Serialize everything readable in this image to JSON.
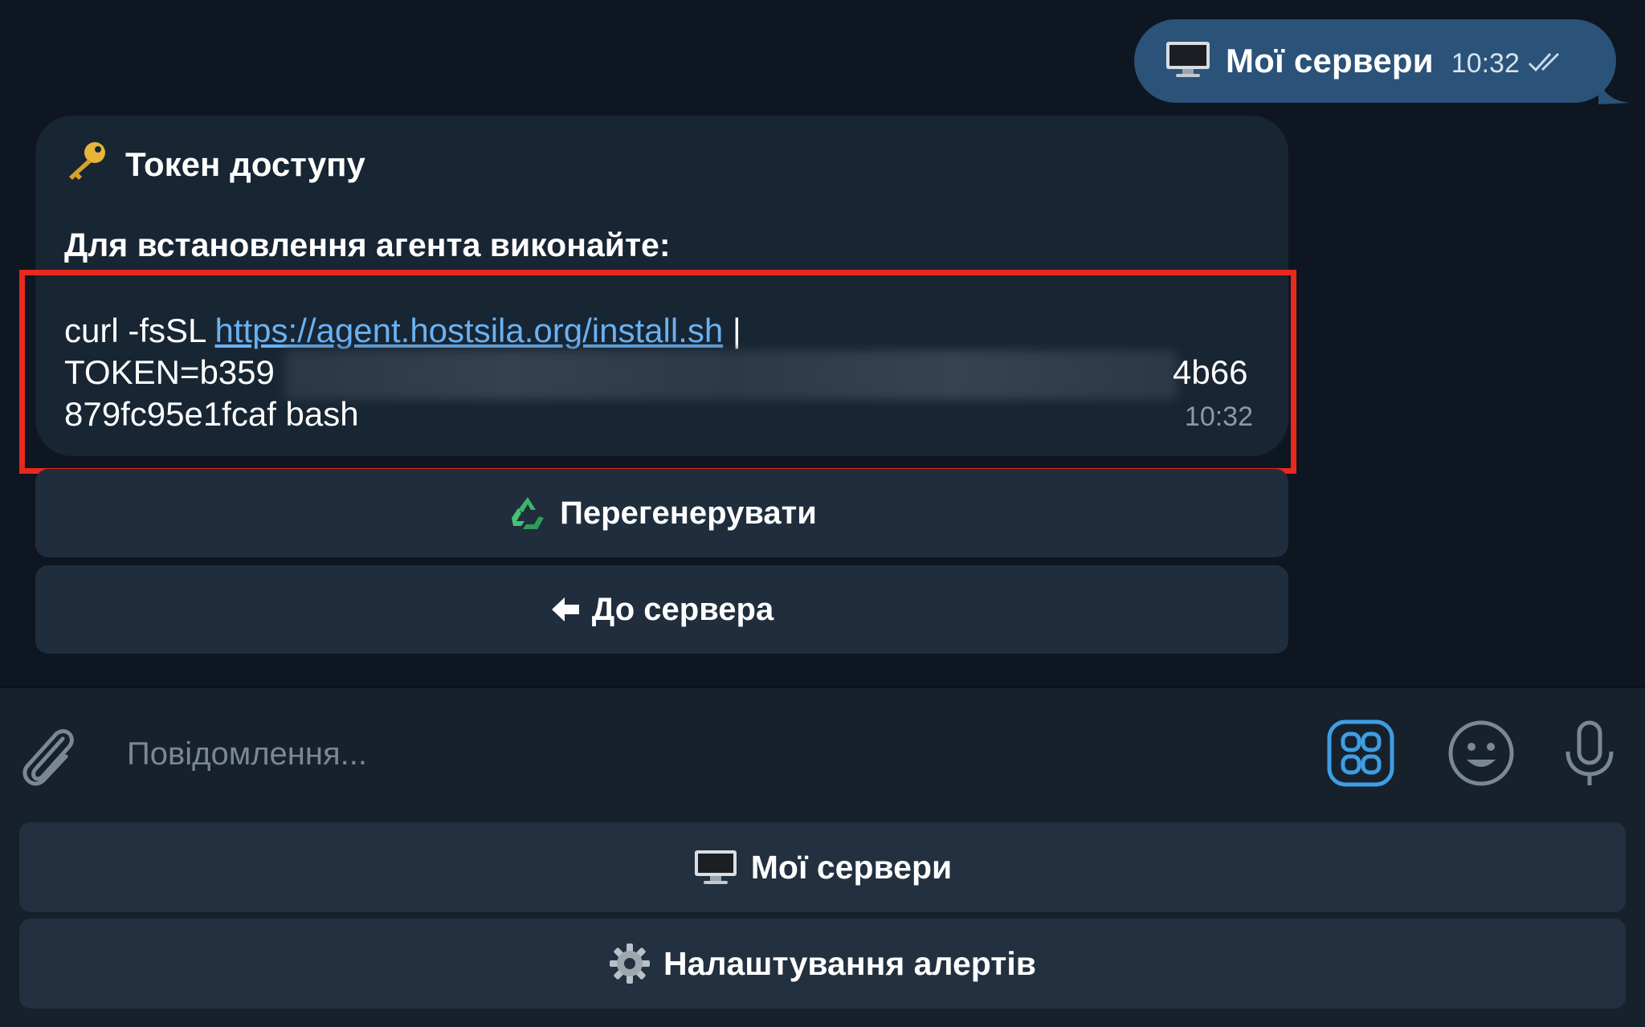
{
  "outgoing": {
    "text": "Мої сервери",
    "time": "10:32"
  },
  "incoming": {
    "title": "Токен доступу",
    "instruction": "Для встановлення агента виконайте:",
    "cmd_prefix": "curl -fsSL ",
    "cmd_link": "https://agent.hostsila.org/install.sh",
    "cmd_pipe": " |",
    "token_start": "TOKEN=b359",
    "token_end": "4b66",
    "token_last": "879fc95e1fcaf bash",
    "time": "10:32"
  },
  "inline_keyboard": {
    "regenerate": "Перегенерувати",
    "back": "До сервера"
  },
  "composer": {
    "placeholder": "Повідомлення..."
  },
  "reply_keyboard": {
    "my_servers": "Мої сервери",
    "alerts": "Налаштування алертів"
  },
  "colors": {
    "background": "#0e1621",
    "outgoing_bubble": "#2b5278",
    "incoming_bubble": "#182533",
    "link": "#6ab2f2",
    "highlight": "#e8291c",
    "accent": "#3e9ee4"
  }
}
